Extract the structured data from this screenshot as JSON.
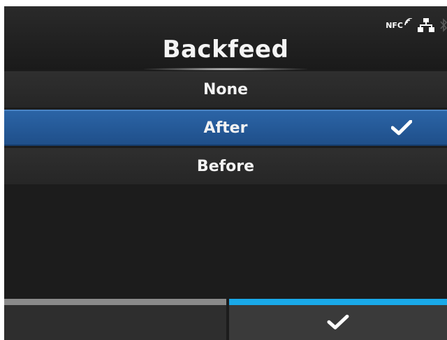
{
  "header": {
    "title": "Backfeed",
    "status": {
      "nfc_label": "NFC",
      "icons": [
        "nfc-icon",
        "lan-icon",
        "bluetooth-icon"
      ]
    }
  },
  "options": [
    {
      "label": "None",
      "selected": false
    },
    {
      "label": "After",
      "selected": true
    },
    {
      "label": "Before",
      "selected": false
    }
  ],
  "softkeys": {
    "left": {
      "icon": "",
      "bar_color": "#8a8a8a"
    },
    "right": {
      "icon": "check-icon",
      "bar_color": "#19a9e8"
    }
  },
  "colors": {
    "selection": "#2b64a6",
    "accent": "#19a9e8",
    "background": "#1c1c1c"
  }
}
